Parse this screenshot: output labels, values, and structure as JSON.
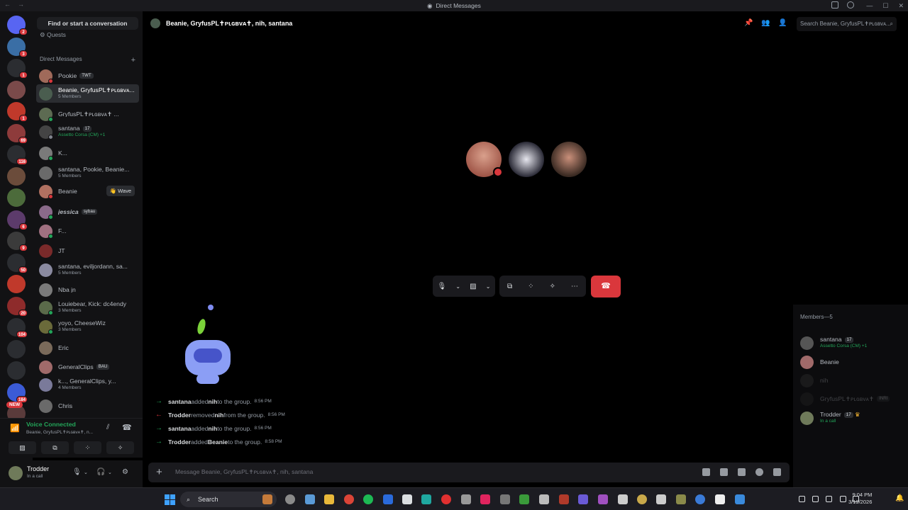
{
  "window": {
    "title": "Direct Messages"
  },
  "sidebar": {
    "find_label": "Find or start a conversation",
    "quests_label": "Quests",
    "dm_header": "Direct Messages",
    "add_icon": "plus-icon",
    "guild_badges": [
      "2",
      "3",
      "1",
      "",
      "1",
      "69",
      "116",
      "",
      "",
      "6",
      "9",
      "50",
      "",
      "20",
      "104",
      "",
      "",
      "184",
      ""
    ],
    "new_label": "NEW",
    "dms": [
      {
        "name": "Pookie",
        "tag": "TWT",
        "sub": ""
      },
      {
        "name": "Beanie, GryfusPL✝ᴘʟɢʙᴠᴀ...",
        "tag": "",
        "sub": "5 Members"
      },
      {
        "name": "GryfusPL✝ᴘʟɢʙᴠᴀ✝ ...",
        "tag": "",
        "sub": ""
      },
      {
        "name": "santana",
        "tag": "17",
        "sub": "Assetto Corsa (CM) +1"
      },
      {
        "name": "K...",
        "tag": "",
        "sub": ""
      },
      {
        "name": "santana, Pookie, Beanie...",
        "tag": "",
        "sub": "5 Members"
      },
      {
        "name": "Beanie",
        "tag": "",
        "sub": ""
      },
      {
        "name": "jessica",
        "tag": "sybau",
        "sub": ""
      },
      {
        "name": "F...",
        "tag": "",
        "sub": ""
      },
      {
        "name": "JT",
        "tag": "",
        "sub": ""
      },
      {
        "name": "santana, eviljordann, sa...",
        "tag": "",
        "sub": "5 Members"
      },
      {
        "name": "Nba jn",
        "tag": "",
        "sub": ""
      },
      {
        "name": "Louiebear, Kick: dc4endy",
        "tag": "",
        "sub": "3 Members"
      },
      {
        "name": "yoyo, CheeseWiz",
        "tag": "",
        "sub": "3 Members"
      },
      {
        "name": "Eric",
        "tag": "",
        "sub": ""
      },
      {
        "name": "GeneralClips",
        "tag": "BAU",
        "sub": ""
      },
      {
        "name": "k..., GeneralClips, y...",
        "tag": "",
        "sub": "4 Members"
      },
      {
        "name": "Chris",
        "tag": "",
        "sub": ""
      }
    ],
    "wave_label": "👋 Wave"
  },
  "voice": {
    "status": "Voice Connected",
    "channel": "Beanie, GryfusPL✝ᴘʟɢʙᴠᴀ✝, n..."
  },
  "user": {
    "name": "Trodder",
    "status": "In a call"
  },
  "header": {
    "title": "Beanie, GryfusPL✝ᴘʟɢʙᴠᴀ✝, nih, santana",
    "search_placeholder": "Search Beanie, GryfusPL✝ᴘʟɢʙᴠᴀ..."
  },
  "messages": [
    {
      "kind": "add",
      "actor": "santana",
      "verb": " added ",
      "target": "nih",
      "rest": " to the group.",
      "time": "8:56 PM"
    },
    {
      "kind": "remove",
      "actor": "Trodder",
      "verb": " removed ",
      "target": "nih",
      "rest": " from the group.",
      "time": "8:56 PM"
    },
    {
      "kind": "add",
      "actor": "santana",
      "verb": " added ",
      "target": "nih",
      "rest": " to the group.",
      "time": "8:56 PM"
    },
    {
      "kind": "add",
      "actor": "Trodder",
      "verb": " added ",
      "target": "Beanie",
      "rest": " to the group.",
      "time": "8:58 PM"
    }
  ],
  "composer": {
    "placeholder": "Message Beanie, GryfusPL✝ᴘʟɢʙᴠᴀ✝, nih, santana"
  },
  "members": {
    "header": "Members—5",
    "list": [
      {
        "name": "santana",
        "tag": "17",
        "sub": "Assetto Corsa (CM) +1"
      },
      {
        "name": "Beanie",
        "tag": "",
        "sub": ""
      },
      {
        "name": "nih",
        "tag": "",
        "sub": ""
      },
      {
        "name": "GryfusPL✝ᴘʟɢʙᴠᴀ✝",
        "tag": "INRI",
        "sub": ""
      },
      {
        "name": "Trodder",
        "tag": "17",
        "sub": "In a call"
      }
    ]
  },
  "taskbar": {
    "search_label": "Search",
    "time": "9:04 PM",
    "date": "3/19/2026"
  },
  "colors": {
    "accent": "#5865f2",
    "danger": "#da373c",
    "online": "#23a559"
  }
}
